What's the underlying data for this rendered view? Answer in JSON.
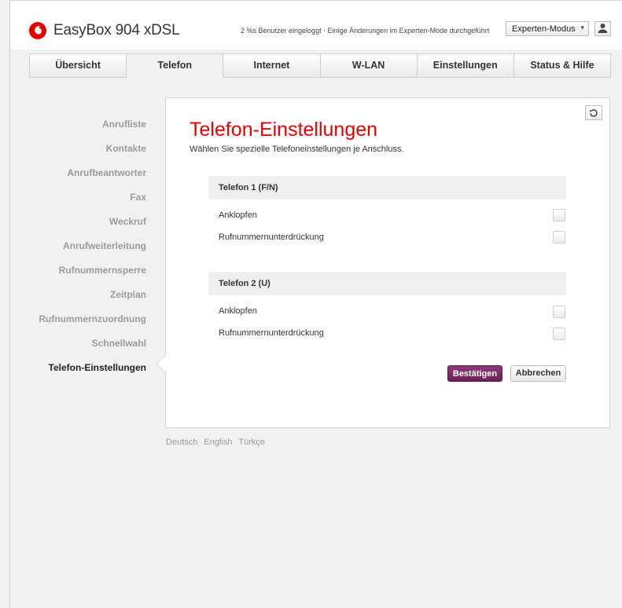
{
  "header": {
    "brand": "EasyBox 904 xDSL",
    "status_text": "2 %s Benutzer eingeloggt · Einige Änderungen im Experten-Mode durchgeführt",
    "mode_select": {
      "selected": "Experten-Modus"
    },
    "icons": {
      "logo": "vodafone-logo",
      "mode_caret": "caret-down-icon",
      "user": "user-icon"
    },
    "brand_color": "#e60000"
  },
  "nav": {
    "tabs": [
      {
        "label": "Übersicht"
      },
      {
        "label": "Telefon",
        "active": true
      },
      {
        "label": "Internet"
      },
      {
        "label": "W-LAN"
      },
      {
        "label": "Einstellungen"
      },
      {
        "label": "Status & Hilfe"
      }
    ]
  },
  "sidebar": {
    "items": [
      {
        "label": "Anrufliste"
      },
      {
        "label": "Kontakte"
      },
      {
        "label": "Anrufbeantworter"
      },
      {
        "label": "Fax"
      },
      {
        "label": "Weckruf"
      },
      {
        "label": "Anrufweiterleitung"
      },
      {
        "label": "Rufnummernsperre"
      },
      {
        "label": "Zeitplan"
      },
      {
        "label": "Rufnummernzuordnung"
      },
      {
        "label": "Schnellwahl"
      },
      {
        "label": "Telefon-Einstellungen",
        "active": true
      }
    ]
  },
  "main": {
    "reset_icon": "reset-icon",
    "title": "Telefon-Einstellungen",
    "subtitle": "Wählen Sie spezielle Telefoneinstellungen je Anschluss.",
    "sections": [
      {
        "heading": "Telefon 1 (F/N)",
        "rows": [
          {
            "label": "Anklopfen",
            "checked": false
          },
          {
            "label": "Rufnummernunterdrückung",
            "checked": false
          }
        ]
      },
      {
        "heading": "Telefon 2 (U)",
        "rows": [
          {
            "label": "Anklopfen",
            "checked": false
          },
          {
            "label": "Rufnummernunterdrückung",
            "checked": false
          }
        ]
      }
    ],
    "confirm_label": "Bestätigen",
    "cancel_label": "Abbrechen",
    "accent_color": "#7a2a66"
  },
  "footer": {
    "languages": [
      "Deutsch",
      "English",
      "Türkçe"
    ]
  }
}
